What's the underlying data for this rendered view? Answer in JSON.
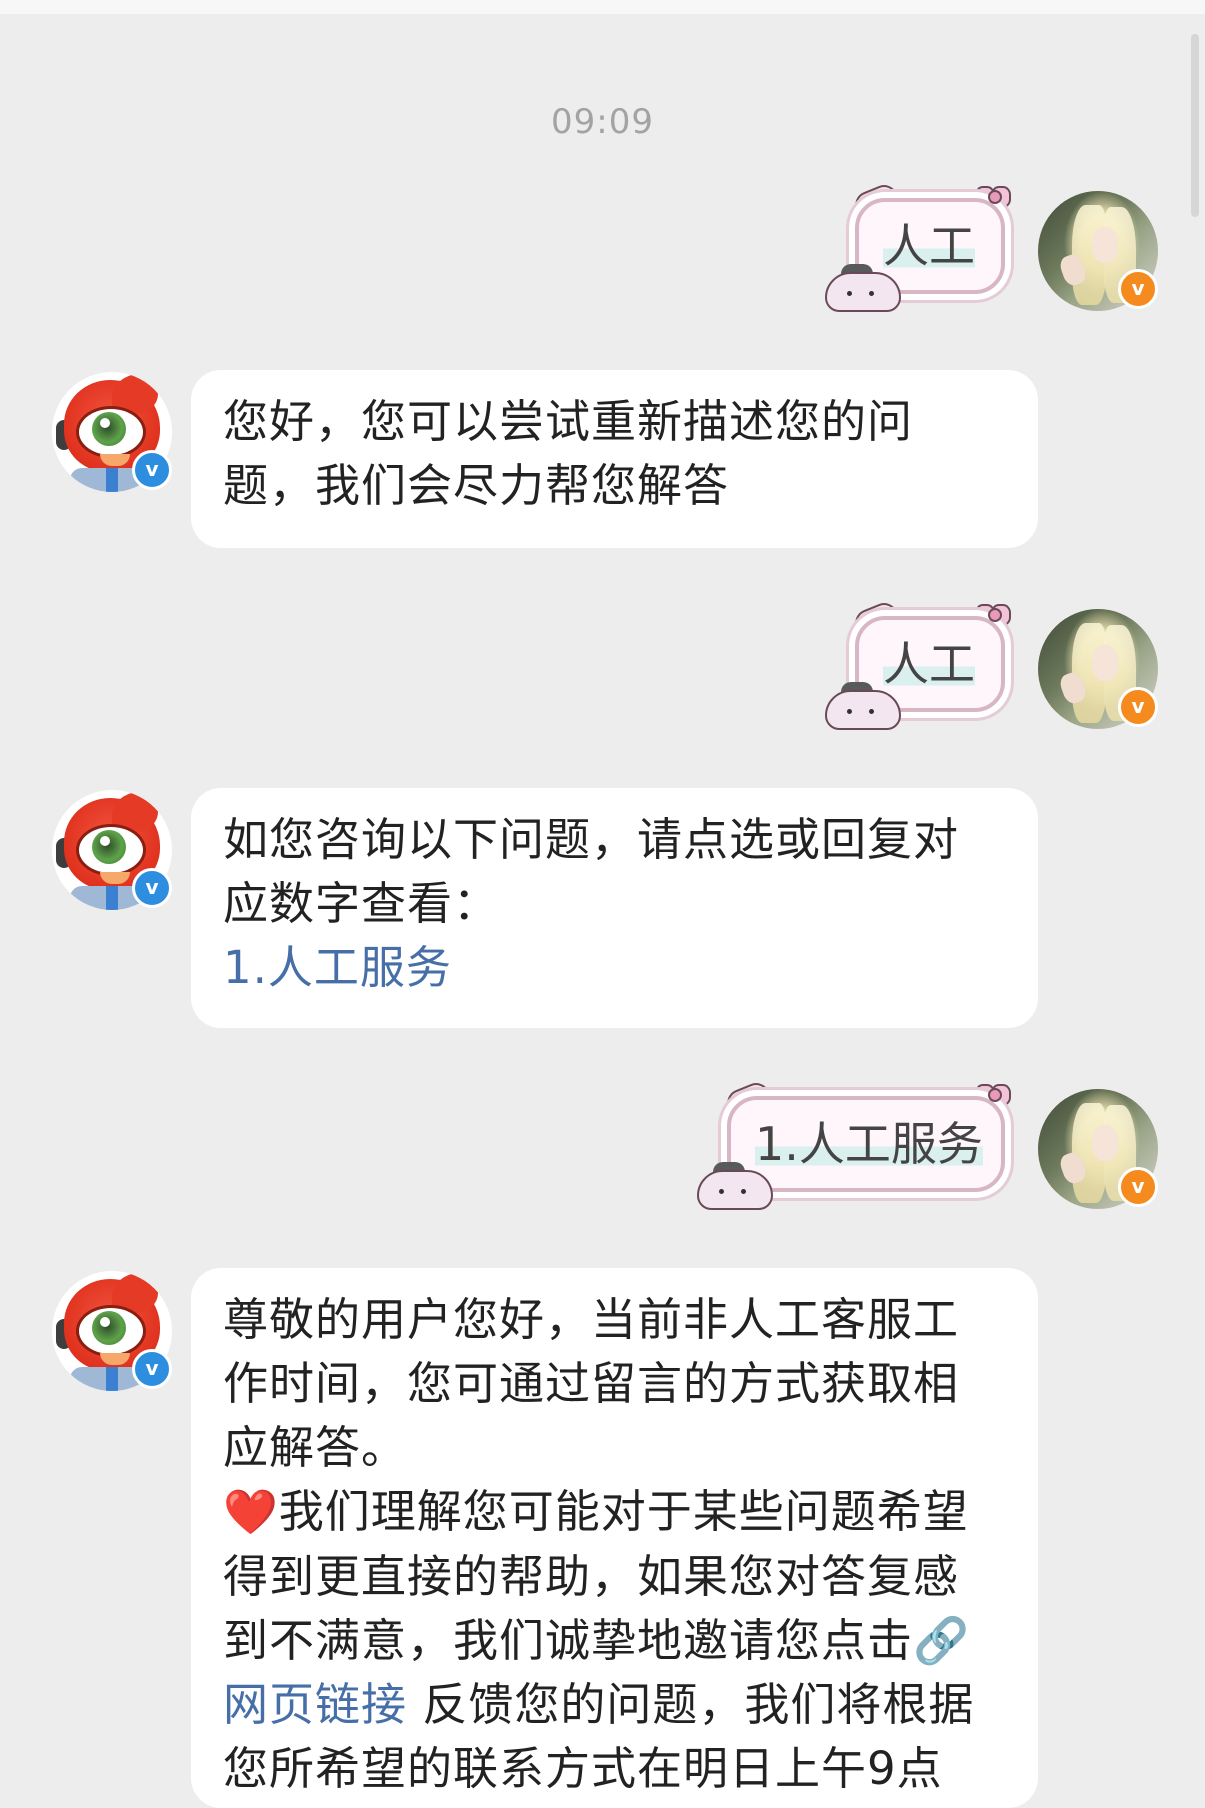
{
  "time_divider": "09:09",
  "messages": [
    {
      "sender": "user",
      "type": "sticker",
      "text": "人工"
    },
    {
      "sender": "service",
      "type": "text",
      "lines": [
        "您好，您可以尝试重新描述您的问",
        "题，我们会尽力帮您解答"
      ]
    },
    {
      "sender": "user",
      "type": "sticker",
      "text": "人工"
    },
    {
      "sender": "service",
      "type": "text",
      "lines": [
        "如您咨询以下问题，请点选或回复对",
        "应数字查看："
      ],
      "link": "1.人工服务"
    },
    {
      "sender": "user",
      "type": "sticker",
      "text": "1.人工服务"
    },
    {
      "sender": "service",
      "type": "text",
      "lines": [
        "尊敬的用户您好，当前非人工客服工",
        "作时间，您可通过留言的方式获取相",
        "应解答。"
      ],
      "heart": "❤️",
      "line4": "我们理解您可能对于某些问题希望",
      "line5": "得到更直接的帮助，如果您对答复感",
      "line6": "到不满意，我们诚挚地邀请您点击",
      "link_icon": "🔗",
      "link_text": "网页链接",
      "line7_rest": " 反馈您的问题，我们将根据",
      "line8": "您所希望的联系方式在明日上午9点"
    }
  ],
  "badges": {
    "user": "v",
    "service": "v"
  },
  "colors": {
    "background": "#ededed",
    "bubble": "#ffffff",
    "link": "#466fa8",
    "user_badge": "#f58a1f",
    "service_badge": "#2d8ee0",
    "service_avatar": "#e0321f"
  },
  "icons": {
    "user_avatar": "user-avatar-photo",
    "service_avatar": "weibo-service-mascot",
    "verified": "verified-badge-icon",
    "link": "link-icon",
    "heart": "heart-icon"
  }
}
